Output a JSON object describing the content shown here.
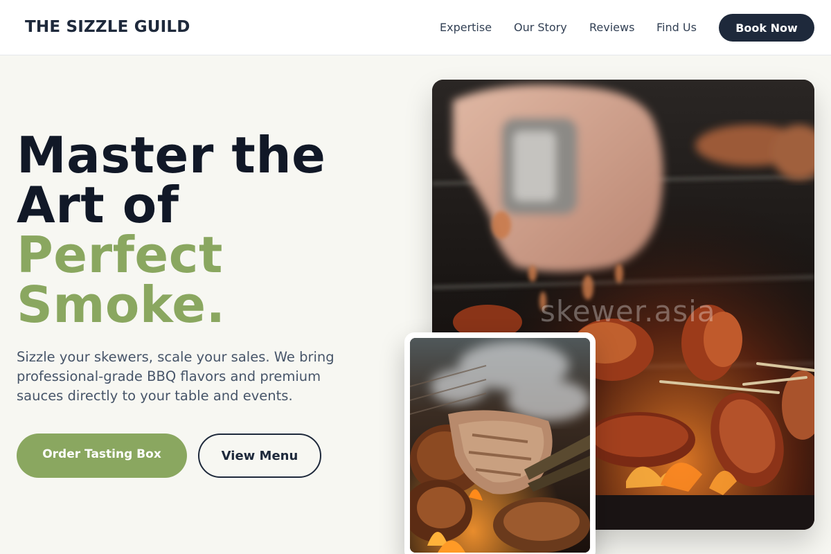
{
  "brand": {
    "name": "THE SIZZLE GUILD"
  },
  "nav": {
    "links": [
      {
        "label": "Expertise"
      },
      {
        "label": "Our Story"
      },
      {
        "label": "Reviews"
      },
      {
        "label": "Find Us"
      }
    ],
    "cta_label": "Book Now"
  },
  "hero": {
    "headline_line1": "Master the",
    "headline_line2": "Art of",
    "headline_accent_line1": "Perfect",
    "headline_accent_line2": "Smoke.",
    "subtext": "Sizzle your skewers, scale your sales. We bring professional-grade BBQ flavors and premium sauces directly to your table and events.",
    "primary_cta": "Order Tasting Box",
    "secondary_cta": "View Menu"
  },
  "images": {
    "main_watermark": "skewer.asia"
  },
  "colors": {
    "accent": "#8aa760",
    "dark": "#1e293b",
    "background": "#f7f7f2"
  }
}
